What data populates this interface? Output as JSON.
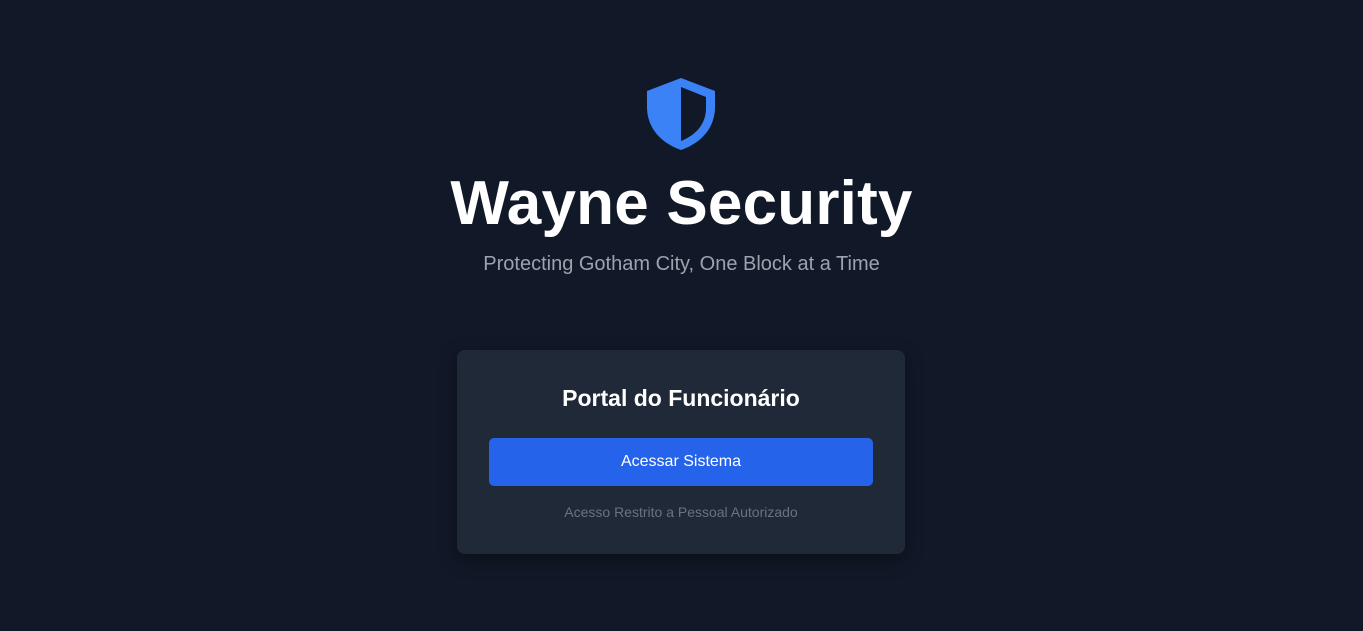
{
  "header": {
    "logo_icon": "shield-icon",
    "accent_color": "#3b82f6",
    "title": "Wayne Security",
    "subtitle": "Protecting Gotham City, One Block at a Time"
  },
  "portal_card": {
    "title": "Portal do Funcionário",
    "access_button_label": "Acessar Sistema",
    "restricted_note": "Acesso Restrito a Pessoal Autorizado",
    "button_color": "#2563eb"
  },
  "theme": {
    "background": "#111827",
    "card_background": "#1f2937"
  }
}
